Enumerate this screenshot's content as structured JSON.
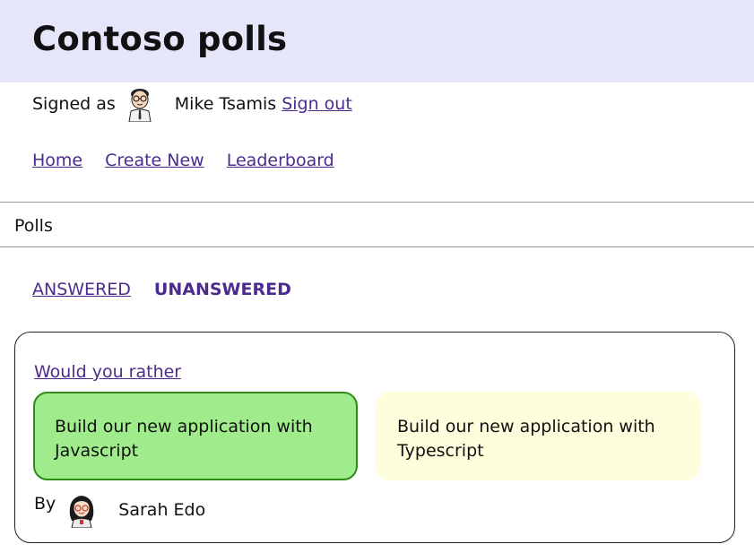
{
  "header": {
    "title": "Contoso polls"
  },
  "user": {
    "signed_label": "Signed as",
    "name": "Mike Tsamis",
    "sign_out": "Sign out"
  },
  "nav": {
    "home": "Home",
    "create_new": "Create New",
    "leaderboard": "Leaderboard"
  },
  "section": {
    "title": "Polls"
  },
  "tabs": {
    "answered": "ANSWERED",
    "unanswered": "UNANSWERED",
    "active": "UNANSWERED"
  },
  "poll": {
    "question": "Would you rather",
    "option_one": "Build our new application with Javascript",
    "option_two": "Build our new application with Typescript",
    "by_label": "By",
    "author": "Sarah Edo"
  },
  "colors": {
    "header_bg": "#e6e6fa",
    "link": "#4b2c8c",
    "option_selected": "#a0ec8c",
    "option_other": "#fefddc"
  }
}
